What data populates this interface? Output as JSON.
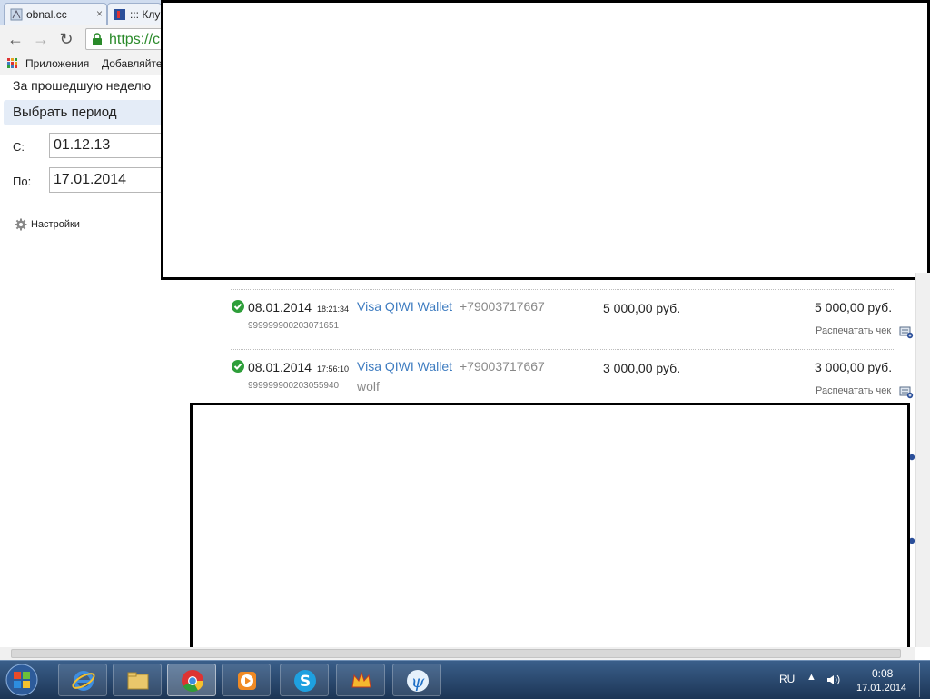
{
  "browser": {
    "tabs": [
      {
        "title": "obnal.cc"
      },
      {
        "title": "::: Клу"
      }
    ],
    "address": {
      "url": "https://c"
    },
    "bookmarks": {
      "apps_label": "Приложения",
      "item_label": "Добавляйте"
    }
  },
  "filters": {
    "last_week_label": "За прошедшую неделю",
    "choose_period_label": "Выбрать период",
    "from_label": "С:",
    "from_value": "01.12.13",
    "to_label": "По:",
    "to_value": "17.01.2014",
    "settings_label": "Настройки"
  },
  "transactions": [
    {
      "date": "08.01.2014",
      "time": "18:21:34",
      "id": "999999900203071651",
      "provider": "Visa QIWI Wallet",
      "phone": "+79003717667",
      "comment": "",
      "amount": "5 000,00 руб.",
      "total": "5 000,00 руб.",
      "print_label": "Распечатать чек"
    },
    {
      "date": "08.01.2014",
      "time": "17:56:10",
      "id": "999999900203055940",
      "provider": "Visa QIWI Wallet",
      "phone": "+79003717667",
      "comment": "wolf",
      "amount": "3 000,00 руб.",
      "total": "3 000,00 руб.",
      "print_label": "Распечатать чек"
    }
  ],
  "taskbar": {
    "language": "RU",
    "time": "0:08",
    "date": "17.01.2014"
  },
  "colors": {
    "accent_link": "#3e7cc0",
    "success": "#2e9e3a"
  }
}
